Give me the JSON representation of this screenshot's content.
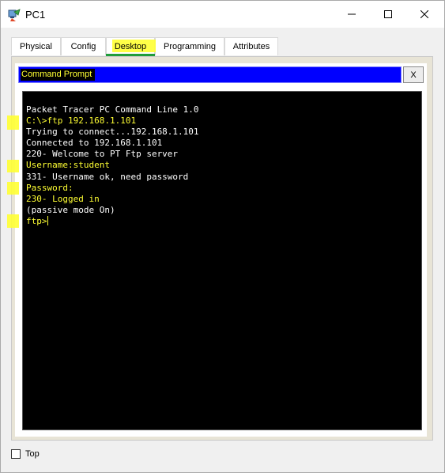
{
  "window": {
    "title": "PC1",
    "minimize_icon": "minimize-icon",
    "maximize_icon": "maximize-icon",
    "close_icon": "close-icon"
  },
  "tabs": [
    {
      "label": "Physical"
    },
    {
      "label": "Config"
    },
    {
      "label": "Desktop",
      "active": true
    },
    {
      "label": "Programming"
    },
    {
      "label": "Attributes"
    }
  ],
  "command_prompt": {
    "title": "Command Prompt",
    "close_label": "X",
    "lines": [
      {
        "text": "Packet Tracer PC Command Line 1.0",
        "color": "#ffffff"
      },
      {
        "text": "C:\\>ftp 192.168.1.101",
        "color": "#ffff33"
      },
      {
        "text": "Trying to connect...192.168.1.101",
        "color": "#ffffff"
      },
      {
        "text": "Connected to 192.168.1.101",
        "color": "#ffffff"
      },
      {
        "text": "220- Welcome to PT Ftp server",
        "color": "#ffffff"
      },
      {
        "text": "Username:student",
        "color": "#ffff33"
      },
      {
        "text": "331- Username ok, need password",
        "color": "#ffffff"
      },
      {
        "text": "Password:",
        "color": "#ffff33"
      },
      {
        "text": "230- Logged in",
        "color": "#ffff33"
      },
      {
        "text": "(passive mode On)",
        "color": "#ffffff"
      },
      {
        "text": "ftp>",
        "color": "#ffff33"
      }
    ]
  },
  "footer": {
    "top_label": "Top",
    "top_checked": false
  },
  "colors": {
    "highlight": "#ffff33",
    "cmd_bar": "#0000ff",
    "terminal_bg": "#000000",
    "tab_underline": "#1f9d3a"
  }
}
